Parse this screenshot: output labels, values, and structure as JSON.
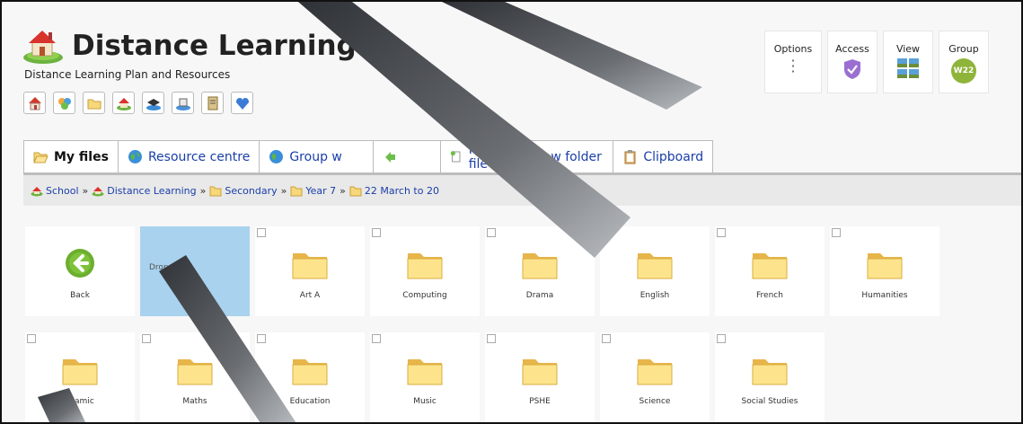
{
  "header": {
    "title": "Distance Learning",
    "subtitle": "Distance Learning Plan and Resources",
    "quick_icons": [
      "home-icon",
      "palette-icon",
      "folder-icon",
      "school-icon",
      "graduation-cap-icon",
      "book-icon",
      "notebook-icon",
      "heart-shield-icon"
    ]
  },
  "panel_buttons": {
    "options": "Options",
    "access": "Access",
    "view": "View",
    "group": "Group",
    "group_badge": "W22"
  },
  "tabs": [
    {
      "label": "My files",
      "icon": "open-folder-icon",
      "active": true
    },
    {
      "label": "Resource centre",
      "icon": "globe-icon"
    },
    {
      "label": "Group w",
      "icon": "globe-icon"
    },
    {
      "label": "",
      "icon": "arrow-icon"
    },
    {
      "label": "New file",
      "icon": "new-file-icon"
    },
    {
      "label": "w folder",
      "icon": "new-folder-icon"
    },
    {
      "label": "Clipboard",
      "icon": "clipboard-icon"
    }
  ],
  "breadcrumb": [
    {
      "label": "School",
      "icon": "school-icon"
    },
    {
      "label": "Distance Learning",
      "icon": "school-icon"
    },
    {
      "label": "Secondary",
      "icon": "folder-icon"
    },
    {
      "label": "Year 7",
      "icon": "folder-icon"
    },
    {
      "label": "22 March to 20",
      "icon": "folder-icon"
    }
  ],
  "tiles_row1": [
    {
      "label": "Back",
      "kind": "back"
    },
    {
      "label": "Drop fil",
      "kind": "drop"
    },
    {
      "label": "Art A",
      "kind": "folder"
    },
    {
      "label": "Computing",
      "kind": "folder"
    },
    {
      "label": "Drama",
      "kind": "folder"
    },
    {
      "label": "English",
      "kind": "folder"
    },
    {
      "label": "French",
      "kind": "folder"
    },
    {
      "label": "Humanities",
      "kind": "folder"
    }
  ],
  "tiles_row2": [
    {
      "label": "Islamic",
      "kind": "folder"
    },
    {
      "label": "Maths",
      "kind": "folder"
    },
    {
      "label": "Education",
      "kind": "folder"
    },
    {
      "label": "Music",
      "kind": "folder"
    },
    {
      "label": "PSHE",
      "kind": "folder"
    },
    {
      "label": "Science",
      "kind": "folder"
    },
    {
      "label": "Social Studies",
      "kind": "folder"
    }
  ],
  "colors": {
    "link": "#1a3ea8",
    "drop_zone": "#a9d2ee",
    "group_badge": "#8fb43a",
    "folder": "#f6d77a"
  }
}
